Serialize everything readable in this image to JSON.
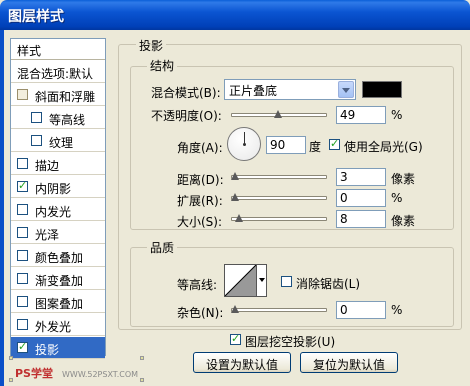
{
  "window": {
    "title": "图层样式"
  },
  "styles_list": {
    "header": "样式",
    "items": [
      {
        "label": "混合选项:默认",
        "checkbox": "none",
        "indent": false
      },
      {
        "label": "斜面和浮雕",
        "checkbox": "plain",
        "checked": false,
        "indent": false
      },
      {
        "label": "等高线",
        "checkbox": "box",
        "checked": false,
        "indent": true
      },
      {
        "label": "纹理",
        "checkbox": "box",
        "checked": false,
        "indent": true
      },
      {
        "label": "描边",
        "checkbox": "box",
        "checked": false,
        "indent": false
      },
      {
        "label": "内阴影",
        "checkbox": "box",
        "checked": true,
        "indent": false
      },
      {
        "label": "内发光",
        "checkbox": "box",
        "checked": false,
        "indent": false
      },
      {
        "label": "光泽",
        "checkbox": "box",
        "checked": false,
        "indent": false
      },
      {
        "label": "颜色叠加",
        "checkbox": "box",
        "checked": false,
        "indent": false
      },
      {
        "label": "渐变叠加",
        "checkbox": "box",
        "checked": false,
        "indent": false
      },
      {
        "label": "图案叠加",
        "checkbox": "box",
        "checked": false,
        "indent": false
      },
      {
        "label": "外发光",
        "checkbox": "box",
        "checked": false,
        "indent": false
      },
      {
        "label": "投影",
        "checkbox": "box",
        "checked": true,
        "indent": false,
        "selected": true
      }
    ]
  },
  "drop_shadow": {
    "section_title": "投影",
    "structure": {
      "title": "结构",
      "blend_mode_label": "混合模式(B):",
      "blend_mode_value": "正片叠底",
      "color": "#000000",
      "opacity_label": "不透明度(O):",
      "opacity_value": "49",
      "opacity_unit": "%",
      "opacity_fraction": 0.49,
      "angle_label": "角度(A):",
      "angle_value": "90",
      "angle_unit": "度",
      "global_light_label": "使用全局光(G)",
      "global_light_checked": true,
      "distance_label": "距离(D):",
      "distance_value": "3",
      "distance_unit": "像素",
      "spread_label": "扩展(R):",
      "spread_value": "0",
      "spread_unit": "%",
      "size_label": "大小(S):",
      "size_value": "8",
      "size_unit": "像素"
    },
    "quality": {
      "title": "品质",
      "contour_label": "等高线:",
      "anti_alias_label": "消除锯齿(L)",
      "anti_alias_checked": false,
      "noise_label": "杂色(N):",
      "noise_value": "0",
      "noise_unit": "%"
    },
    "knockout_label": "图层挖空投影(U)",
    "knockout_checked": true,
    "set_default_button": "设置为默认值",
    "reset_default_button": "复位为默认值"
  },
  "watermark": {
    "left": "PS学堂",
    "right": "WWW.52PSXT.COM"
  }
}
